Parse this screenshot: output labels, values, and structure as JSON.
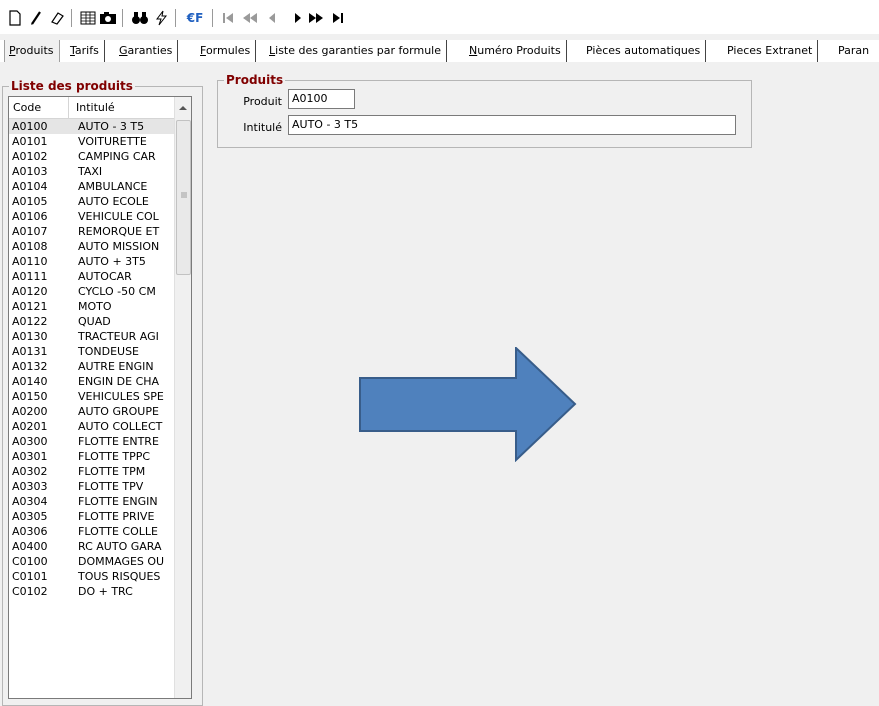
{
  "toolbar": {
    "buttons": [
      {
        "name": "new-document-icon"
      },
      {
        "name": "edit-pencil-icon"
      },
      {
        "name": "eraser-icon"
      },
      {
        "name": "grid-icon"
      },
      {
        "name": "camera-icon"
      },
      {
        "name": "binoculars-icon"
      },
      {
        "name": "lightning-icon"
      },
      {
        "name": "euro-icon",
        "label": "€F"
      },
      {
        "name": "first-record-icon"
      },
      {
        "name": "rewind-icon"
      },
      {
        "name": "previous-icon"
      },
      {
        "name": "next-icon"
      },
      {
        "name": "fast-forward-icon"
      },
      {
        "name": "last-record-icon"
      }
    ]
  },
  "tabs": [
    {
      "key": "P",
      "rest": "roduits",
      "active": true
    },
    {
      "key": "T",
      "rest": "arifs"
    },
    {
      "key": "G",
      "rest": "aranties"
    },
    {
      "key": "F",
      "rest": "ormules"
    },
    {
      "key": "L",
      "rest": "iste des garanties par formule"
    },
    {
      "key": "N",
      "rest": "uméro Produits"
    },
    {
      "key": "",
      "rest": "Pièces automatiques"
    },
    {
      "key": "",
      "rest": "Pieces Extranet"
    },
    {
      "key": "",
      "rest": "Paran"
    }
  ],
  "product_list": {
    "title": "Liste des produits",
    "columns": [
      "Code",
      "Intitulé"
    ],
    "rows": [
      [
        "A0100",
        "AUTO  - 3 T5"
      ],
      [
        "A0101",
        "VOITURETTE"
      ],
      [
        "A0102",
        "CAMPING CAR"
      ],
      [
        "A0103",
        "TAXI"
      ],
      [
        "A0104",
        "AMBULANCE"
      ],
      [
        "A0105",
        "AUTO ECOLE"
      ],
      [
        "A0106",
        "VEHICULE COL"
      ],
      [
        "A0107",
        "REMORQUE ET"
      ],
      [
        "A0108",
        "AUTO MISSION"
      ],
      [
        "A0110",
        "AUTO + 3T5"
      ],
      [
        "A0111",
        "AUTOCAR"
      ],
      [
        "A0120",
        "CYCLO -50 CM"
      ],
      [
        "A0121",
        "MOTO"
      ],
      [
        "A0122",
        "QUAD"
      ],
      [
        "A0130",
        "TRACTEUR AGI"
      ],
      [
        "A0131",
        "TONDEUSE"
      ],
      [
        "A0132",
        "AUTRE ENGIN"
      ],
      [
        "A0140",
        "ENGIN DE CHA"
      ],
      [
        "A0150",
        "VEHICULES SPE"
      ],
      [
        "A0200",
        "AUTO GROUPE"
      ],
      [
        "A0201",
        "AUTO COLLECT"
      ],
      [
        "A0300",
        "FLOTTE ENTRE"
      ],
      [
        "A0301",
        "FLOTTE TPPC"
      ],
      [
        "A0302",
        "FLOTTE TPM"
      ],
      [
        "A0303",
        "FLOTTE TPV"
      ],
      [
        "A0304",
        "FLOTTE ENGIN"
      ],
      [
        "A0305",
        "FLOTTE PRIVE"
      ],
      [
        "A0306",
        "FLOTTE COLLE"
      ],
      [
        "A0400",
        "RC AUTO GARA"
      ],
      [
        "C0100",
        "DOMMAGES OU"
      ],
      [
        "C0101",
        "TOUS RISQUES"
      ],
      [
        "C0102",
        "DO + TRC"
      ]
    ],
    "selected_index": 0
  },
  "product_form": {
    "title": "Produits",
    "produit_label": "Produit",
    "produit_value": "A0100",
    "intitule_label": "Intitulé",
    "intitule_value": "AUTO  - 3 T5"
  },
  "colors": {
    "group_title": "#800000",
    "arrow_fill": "#4f81bd",
    "arrow_stroke": "#385d8a"
  }
}
